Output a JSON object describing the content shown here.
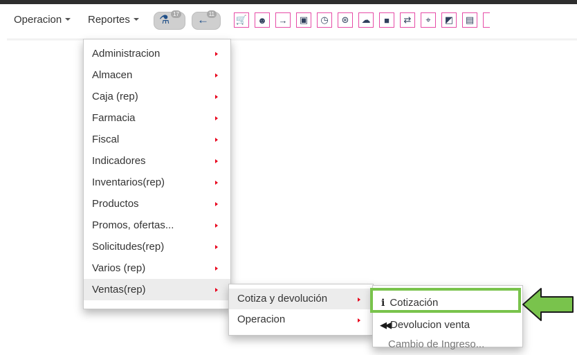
{
  "navbar": {
    "operacion_label": "Operacion",
    "reportes_label": "Reportes",
    "badge1": "17",
    "badge2": "11"
  },
  "toolbar_icons": [
    "cart-icon",
    "user-icon",
    "sign-in-icon",
    "document-icon",
    "clock-icon",
    "steering-icon",
    "cloud-icon",
    "truck-icon",
    "exchange-icon",
    "map-marker-icon",
    "external-icon",
    "image-icon",
    "edge-icon"
  ],
  "reportes_menu": {
    "items": [
      {
        "label": "Administracion"
      },
      {
        "label": "Almacen"
      },
      {
        "label": "Caja (rep)"
      },
      {
        "label": "Farmacia"
      },
      {
        "label": "Fiscal"
      },
      {
        "label": "Indicadores"
      },
      {
        "label": "Inventarios(rep)"
      },
      {
        "label": "Productos"
      },
      {
        "label": "Promos, ofertas..."
      },
      {
        "label": "Solicitudes(rep)"
      },
      {
        "label": "Varios (rep)"
      },
      {
        "label": "Ventas(rep)"
      }
    ]
  },
  "ventas_submenu": {
    "items": [
      {
        "label": "Cotiza y devolución"
      },
      {
        "label": "Operacion"
      }
    ]
  },
  "cotiza_submenu": {
    "cotizacion": "Cotización",
    "devolucion": "Devolucion venta",
    "next": "Cambio de Ingreso..."
  },
  "colors": {
    "highlight_border": "#79c34c",
    "toolbar_border": "#e64aa6",
    "submenu_arrow": "#e8001b"
  }
}
